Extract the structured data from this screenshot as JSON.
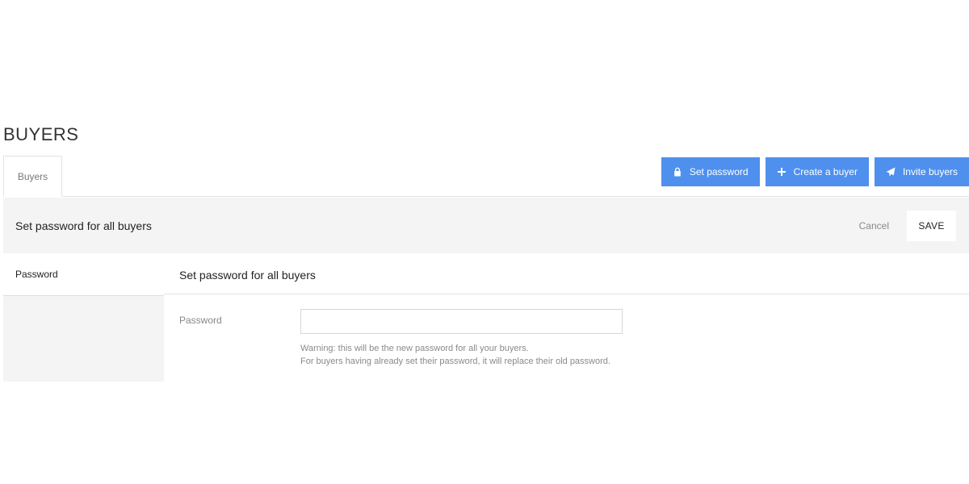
{
  "page": {
    "title": "BUYERS"
  },
  "tabs": [
    {
      "label": "Buyers",
      "active": true
    }
  ],
  "actions": {
    "set_password": {
      "label": "Set password",
      "icon": "lock-icon"
    },
    "create_buyer": {
      "label": "Create a buyer",
      "icon": "plus-icon"
    },
    "invite_buyers": {
      "label": "Invite buyers",
      "icon": "paper-plane-icon"
    }
  },
  "form_header": {
    "title": "Set password for all buyers",
    "cancel_label": "Cancel",
    "save_label": "SAVE"
  },
  "side_nav": {
    "items": [
      {
        "label": "Password"
      }
    ]
  },
  "section": {
    "title": "Set password for all buyers",
    "password_label": "Password",
    "password_value": "",
    "password_placeholder": "",
    "hint_line1": "Warning: this will be the new password for all your buyers.",
    "hint_line2": "For buyers having already set their password, it will replace their old password."
  },
  "colors": {
    "accent": "#4f90ee",
    "panel_bg": "#f4f4f4",
    "border": "#e2e2e2"
  }
}
